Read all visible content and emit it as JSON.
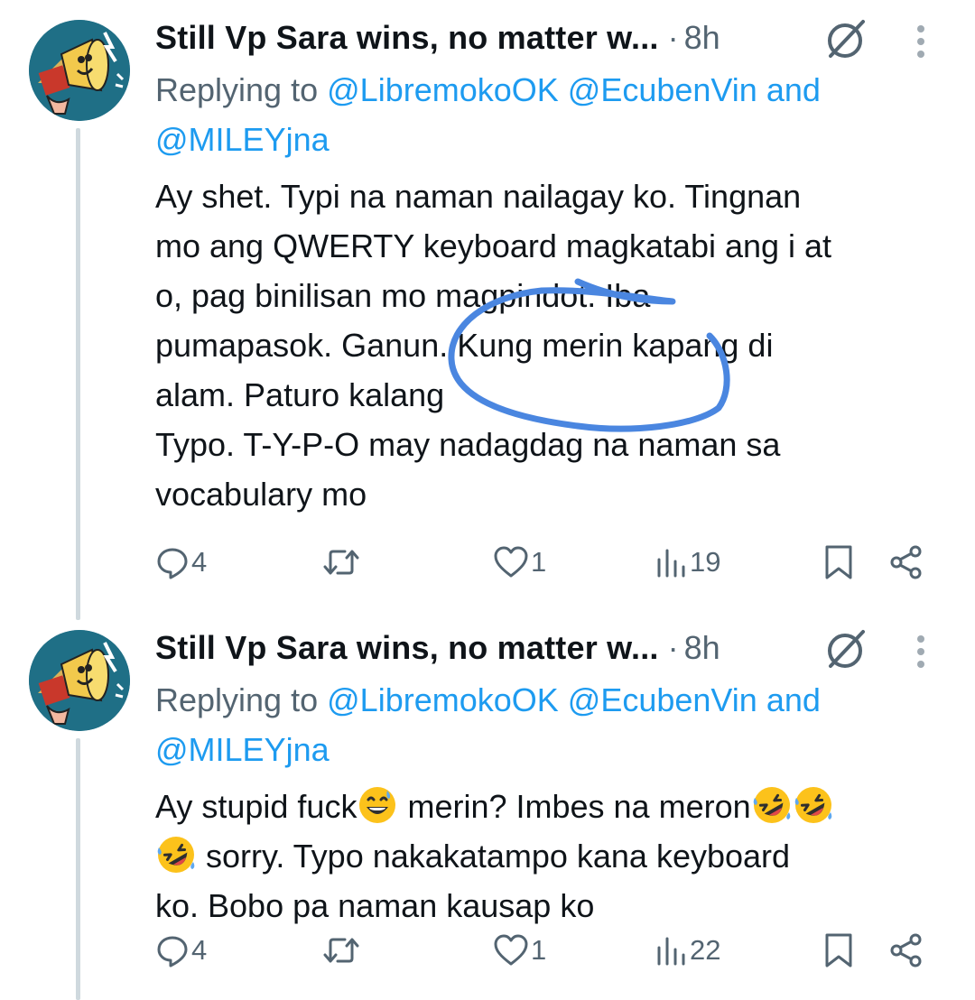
{
  "tweets": [
    {
      "display_name": "Still Vp Sara wins, no matter w...",
      "separator": "·",
      "time": "8h",
      "replying_prefix": "Replying to",
      "mention_1": "@LibremokoOK",
      "mention_2": "@EcubenVin",
      "and_word": "and",
      "mention_3": "@MILEYjna",
      "body_lines": [
        "Ay shet. Typi na naman nailagay ko. Tingnan",
        "mo ang QWERTY keyboard magkatabi ang i at",
        "o, pag binilisan mo magpindot. Iba",
        "pumapasok. Ganun. Kung merin kapang di",
        "alam. Paturo kalang",
        "Typo. T-Y-P-O may nadagdag na naman sa",
        "vocabulary mo"
      ],
      "replies": "4",
      "retweets": "",
      "likes": "1",
      "views": "19"
    },
    {
      "display_name": "Still Vp Sara wins, no matter w...",
      "separator": "·",
      "time": "8h",
      "replying_prefix": "Replying to",
      "mention_1": "@LibremokoOK",
      "mention_2": "@EcubenVin",
      "and_word": "and",
      "mention_3": "@MILEYjna",
      "body_line_1_a": "Ay stupid fuck",
      "body_line_1_b": " merin? Imbes na meron",
      "body_line_2": " sorry. Typo nakakatampo kana keyboard",
      "body_line_3": "ko. Bobo pa naman kausap ko",
      "replies": "4",
      "retweets": "",
      "likes": "1",
      "views": "22"
    }
  ],
  "icons": {
    "avatar": "megaphone-avatar-icon",
    "badge": "circle-slash-icon",
    "more": "vertical-ellipsis-icon",
    "reply": "speech-bubble-icon",
    "retweet": "retweet-icon",
    "like": "heart-icon",
    "views": "bar-chart-icon",
    "bookmark": "bookmark-icon",
    "share": "share-icon",
    "emoji_sweat": "grinning-sweat-emoji",
    "emoji_laugh": "rolling-laughing-emoji"
  },
  "colors": {
    "text": "#0f1419",
    "secondary": "#536471",
    "link": "#1d9bf0",
    "scribble": "#4a86e0",
    "avatar_bg": "#1f6f86"
  }
}
